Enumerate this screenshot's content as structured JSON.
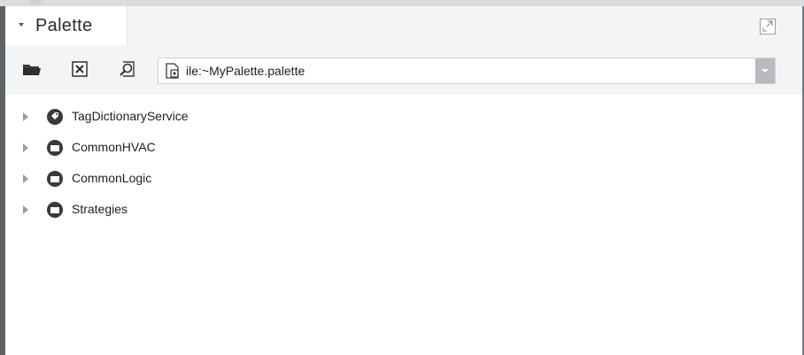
{
  "palette": {
    "title": "Palette",
    "maximize_icon": "maximize-icon"
  },
  "toolbar": {
    "open_icon": "folder-open-icon",
    "close_icon": "close-box-icon",
    "find_icon": "find-icon",
    "file_path": "ile:~MyPalette.palette",
    "file_icon": "palette-file-icon"
  },
  "tree": {
    "items": [
      {
        "label": "TagDictionaryService",
        "icon": "tag-dictionary-icon"
      },
      {
        "label": "CommonHVAC",
        "icon": "folder-icon"
      },
      {
        "label": "CommonLogic",
        "icon": "folder-icon"
      },
      {
        "label": "Strategies",
        "icon": "folder-icon"
      }
    ]
  },
  "colors": {
    "background": "#ffffff",
    "toolbar": "#f3f4f5",
    "icon_dark": "#3a3a3a",
    "dropdown": "#b8babd"
  }
}
